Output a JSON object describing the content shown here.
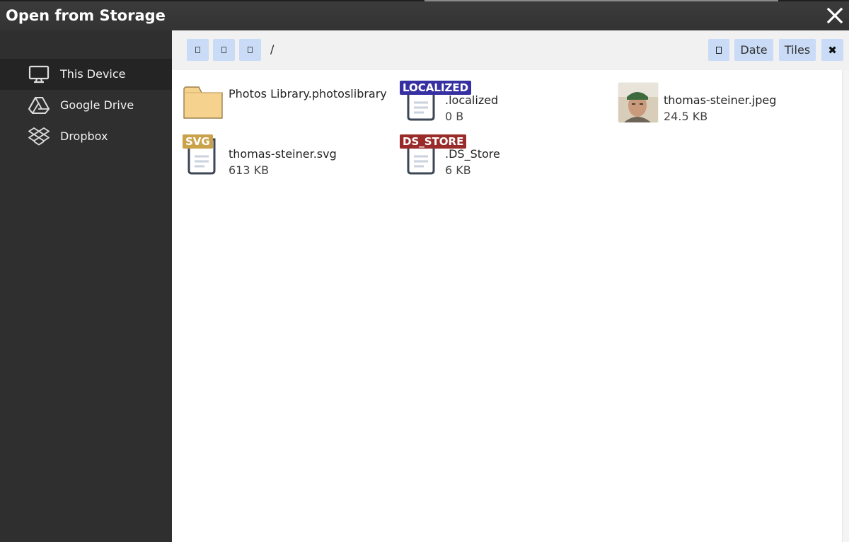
{
  "window": {
    "title": "Open from Storage"
  },
  "sidebar": {
    "items": [
      {
        "label": "This Device",
        "icon": "monitor-icon",
        "active": true
      },
      {
        "label": "Google Drive",
        "icon": "google-drive-icon",
        "active": false
      },
      {
        "label": "Dropbox",
        "icon": "dropbox-icon",
        "active": false
      }
    ]
  },
  "toolbar": {
    "path": "/",
    "date_label": "Date",
    "tiles_label": "Tiles",
    "close_glyph": "✖"
  },
  "files": [
    {
      "name": "Photos Library.photoslibrary",
      "size": "",
      "type": "folder",
      "badge": ""
    },
    {
      "name": ".localized",
      "size": "0 B",
      "type": "document",
      "badge": "LOCALIZED",
      "badge_color": "#3730a3"
    },
    {
      "name": "thomas-steiner.jpeg",
      "size": "24.5 KB",
      "type": "image",
      "badge": ""
    },
    {
      "name": "thomas-steiner.svg",
      "size": "613 KB",
      "type": "document",
      "badge": "SVG",
      "badge_color": "#c9a24a"
    },
    {
      "name": ".DS_Store",
      "size": "6 KB",
      "type": "document",
      "badge": "DS_STORE",
      "badge_color": "#9a2b2b"
    }
  ],
  "colors": {
    "accent_button": "#c9dbf6",
    "sidebar_bg": "#2f2f2f",
    "sidebar_active": "#242424"
  }
}
